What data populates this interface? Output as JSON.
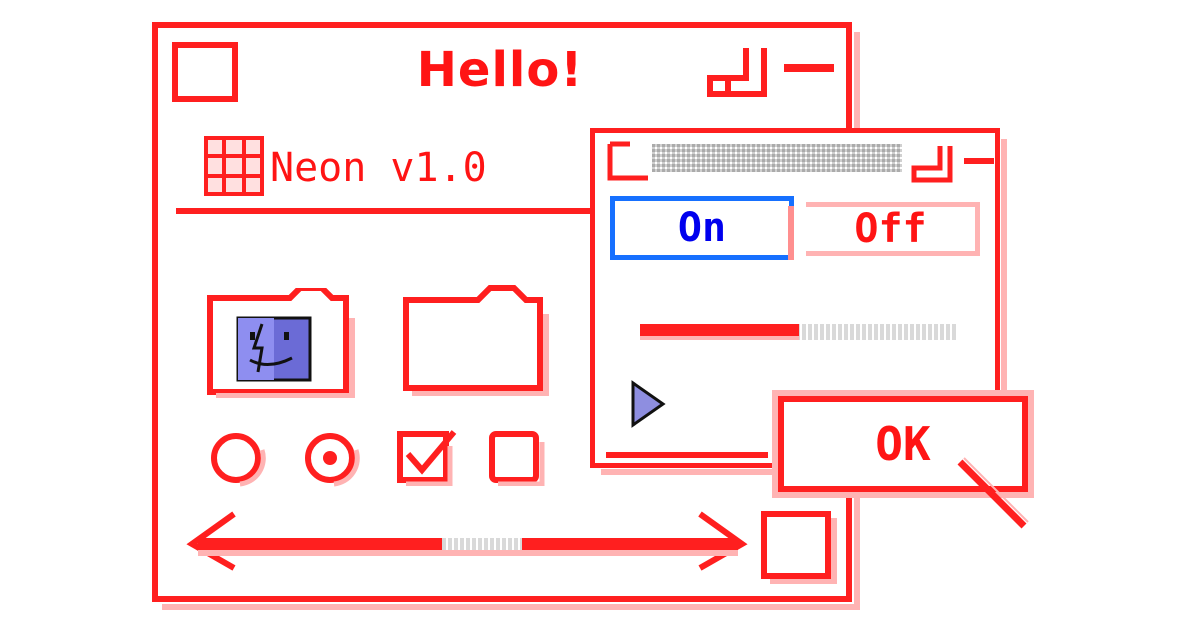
{
  "main_window": {
    "title": "Hello!",
    "menu": {
      "app_label": "Neon v1.0"
    },
    "icons": [
      "finder-folder-icon",
      "empty-folder-icon"
    ],
    "controls": {
      "radio_unchecked": "radio-off",
      "radio_checked": "radio-on",
      "checkbox_checked": "checkbox-on",
      "checkbox_unchecked": "checkbox-off"
    },
    "scrollbar": {
      "position": 0.55
    }
  },
  "sub_window": {
    "toggle": {
      "on_label": "On",
      "off_label": "Off",
      "selected": "On"
    },
    "slider": {
      "value": 0.5
    },
    "play_icon": "triangle-right-icon"
  },
  "ok_button": {
    "label": "OK"
  },
  "colors": {
    "accent": "#ff1f1f",
    "accent_soft": "#ffb3b3",
    "selected_blue": "#1670ff",
    "icon_purple": "#6b6bd6"
  }
}
